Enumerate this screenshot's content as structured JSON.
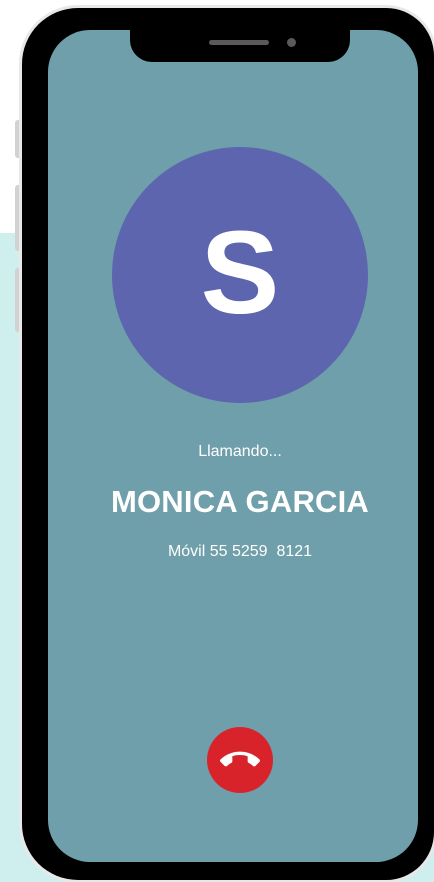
{
  "call": {
    "avatar_initial": "S",
    "status": "Llamando...",
    "contact_name": "MONICA GARCIA",
    "phone_label": "Móvil 55 5259  8121"
  },
  "icons": {
    "end_call": "phone-hangup-icon"
  },
  "colors": {
    "screen_background": "#6f9faa",
    "avatar_background": "#5c65ae",
    "end_call_button": "#d8232a",
    "backdrop": "#cfeeee",
    "phone_bezel": "#000000"
  }
}
